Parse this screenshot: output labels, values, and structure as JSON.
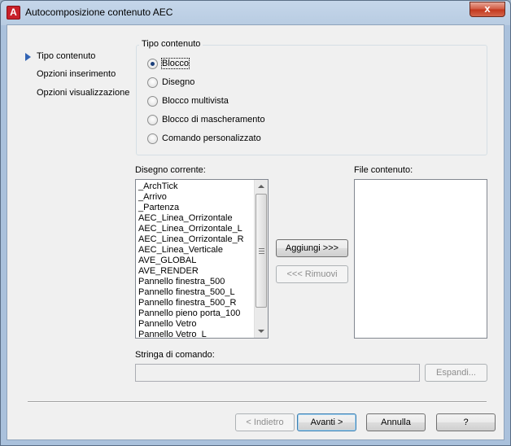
{
  "window": {
    "title": "Autocomposizione contenuto AEC",
    "close_glyph": "x",
    "app_icon_glyph": "A",
    "accent_color": "#c8202a"
  },
  "nav": {
    "items": [
      {
        "label": "Tipo contenuto",
        "active": true
      },
      {
        "label": "Opzioni inserimento",
        "active": false
      },
      {
        "label": "Opzioni visualizzazione",
        "active": false
      }
    ]
  },
  "content_type": {
    "group_title": "Tipo contenuto",
    "options": [
      {
        "label": "Blocco",
        "checked": true
      },
      {
        "label": "Disegno",
        "checked": false
      },
      {
        "label": "Blocco multivista",
        "checked": false
      },
      {
        "label": "Blocco di mascheramento",
        "checked": false
      },
      {
        "label": "Comando personalizzato",
        "checked": false
      }
    ]
  },
  "current_drawing": {
    "label": "Disegno corrente:",
    "items": [
      "_ArchTick",
      "_Arrivo",
      "_Partenza",
      "AEC_Linea_Orrizontale",
      "AEC_Linea_Orrizontale_L",
      "AEC_Linea_Orrizontale_R",
      "AEC_Linea_Verticale",
      "AVE_GLOBAL",
      "AVE_RENDER",
      "Pannello finestra_500",
      "Pannello finestra_500_L",
      "Pannello finestra_500_R",
      "Pannello pieno porta_100",
      "Pannello Vetro",
      "Pannello Vetro_L"
    ]
  },
  "file_content": {
    "label": "File contenuto:"
  },
  "transfer": {
    "add_label": "Aggiungi >>>",
    "remove_label": "<<< Rimuovi"
  },
  "command": {
    "label": "Stringa di comando:",
    "value": "",
    "expand_label": "Espandi..."
  },
  "footer": {
    "back_label": "< Indietro",
    "next_label": "Avanti >",
    "cancel_label": "Annulla",
    "help_label": "?"
  }
}
